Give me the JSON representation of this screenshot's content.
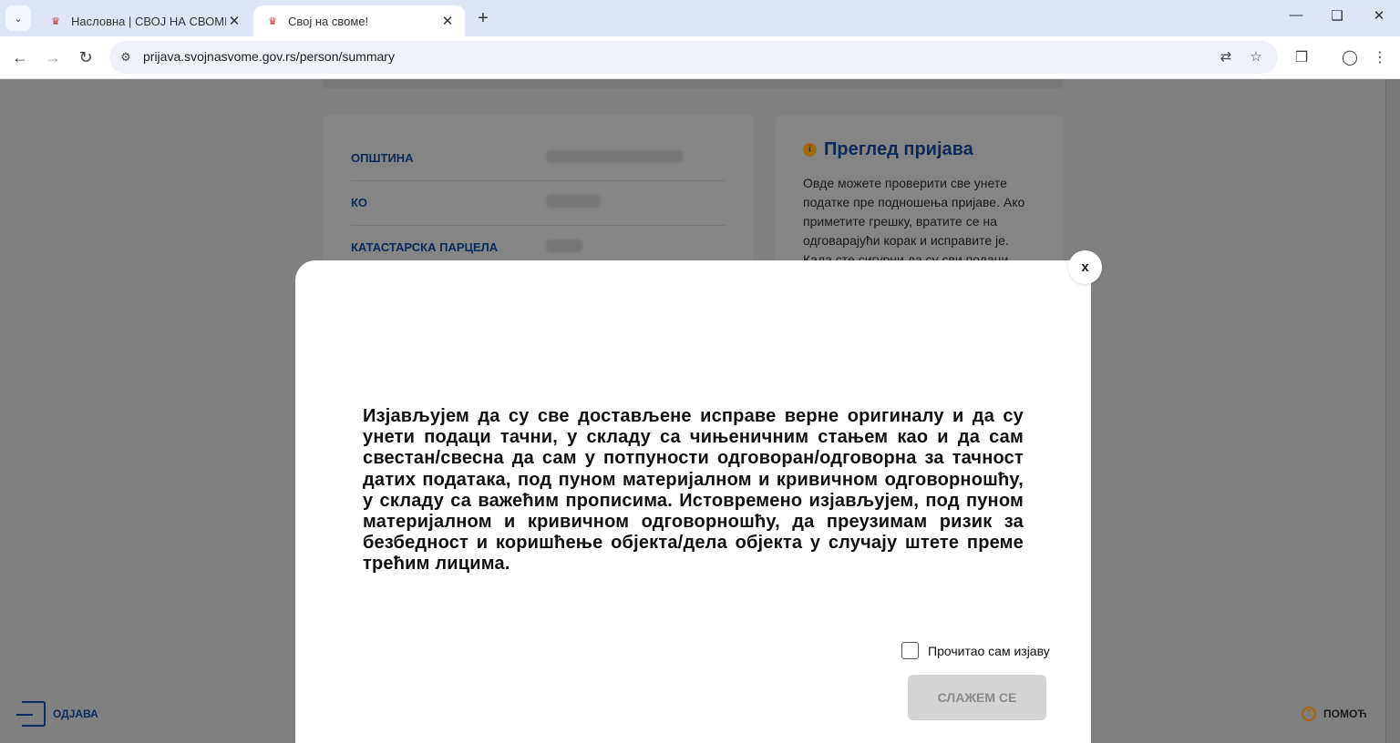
{
  "browser": {
    "tabs": [
      {
        "title": "Насловна | СВОЈ НА СВОМЕ",
        "close": "✕"
      },
      {
        "title": "Свој на своме!",
        "close": "✕"
      }
    ],
    "new_tab": "+",
    "url": "prijava.svojnasvome.gov.rs/person/summary"
  },
  "summary": {
    "fields": [
      {
        "label": "ОПШТИНА"
      },
      {
        "label": "КО"
      },
      {
        "label": "КАТАСТАРСКА ПАРЦЕЛА"
      }
    ]
  },
  "review_panel": {
    "title": "Преглед пријава",
    "text": "Овде можете проверити све унете податке пре подношења пријаве. Ако приметите грешку, вратите се на одговарајући корак и исправите је. Када сте сигурни да су сви подаци"
  },
  "footer": {
    "logout_label": "ОДЈАВА",
    "help_label": "ПОМОЋ"
  },
  "modal": {
    "close_label": "x",
    "statement": "Изјављујем да су све достављене исправе верне оригиналу и да су унети подаци тачни, у складу са чињеничним стањем као и да сам свестан/свесна да сам у потпуности одговоран/одговорна за тачност датих података, под пуном материјалном и кривичном одговорношћу, у складу са важећим прописима. Истовремено изјављујем, под пуном материјалном и кривичном одговорношћу, да преузимам ризик за безбедност и коришћење објекта/дела објекта у случају штете преме трећим лицима.",
    "checkbox_label": "Прочитао сам изјаву",
    "checkbox_checked": false,
    "agree_button": "СЛАЖЕМ СЕ"
  }
}
